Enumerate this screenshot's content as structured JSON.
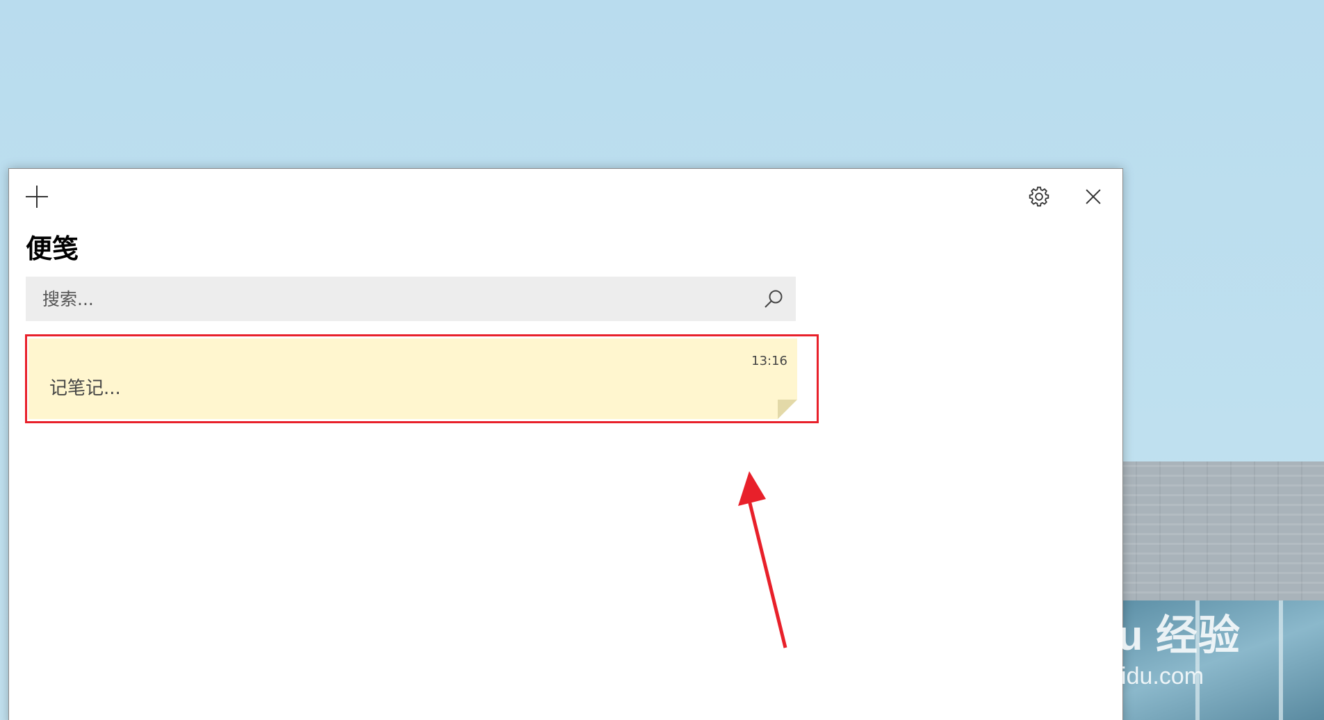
{
  "app": {
    "title": "便笺"
  },
  "toolbar": {
    "add_icon": "plus-icon",
    "settings_icon": "gear-icon",
    "close_icon": "close-icon"
  },
  "search": {
    "placeholder": "搜索...",
    "value": "",
    "icon": "search-icon"
  },
  "notes": [
    {
      "preview": "记笔记...",
      "time": "13:16",
      "color": "#fff6cf"
    }
  ],
  "annotation": {
    "highlight_color": "#e8202a",
    "arrow_color": "#e8202a"
  },
  "watermark": {
    "brand": "Bai du 经验",
    "url": "jingyan.baidu.com"
  }
}
